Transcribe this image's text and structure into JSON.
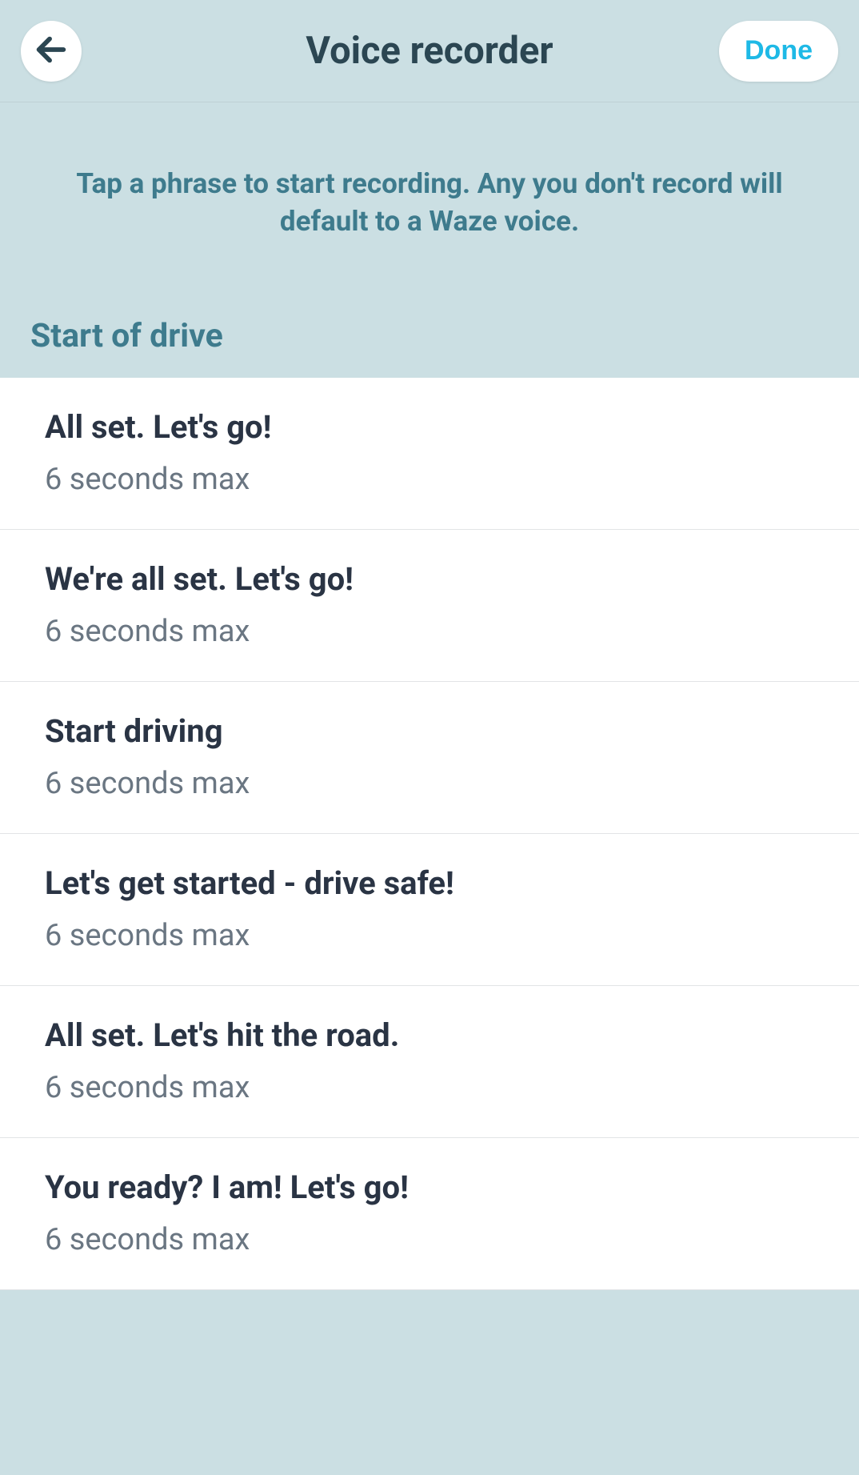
{
  "header": {
    "title": "Voice recorder",
    "done_label": "Done"
  },
  "instruction": "Tap a phrase to start recording. Any you don't record will default to a Waze voice.",
  "section": {
    "title": "Start of drive"
  },
  "phrases": [
    {
      "title": "All set. Let's go!",
      "duration": "6 seconds max"
    },
    {
      "title": "We're all set. Let's go!",
      "duration": "6 seconds max"
    },
    {
      "title": "Start driving",
      "duration": "6 seconds max"
    },
    {
      "title": "Let's get started - drive safe!",
      "duration": "6 seconds max"
    },
    {
      "title": "All set. Let's hit the road.",
      "duration": "6 seconds max"
    },
    {
      "title": "You ready? I am! Let's go!",
      "duration": "6 seconds max"
    }
  ]
}
